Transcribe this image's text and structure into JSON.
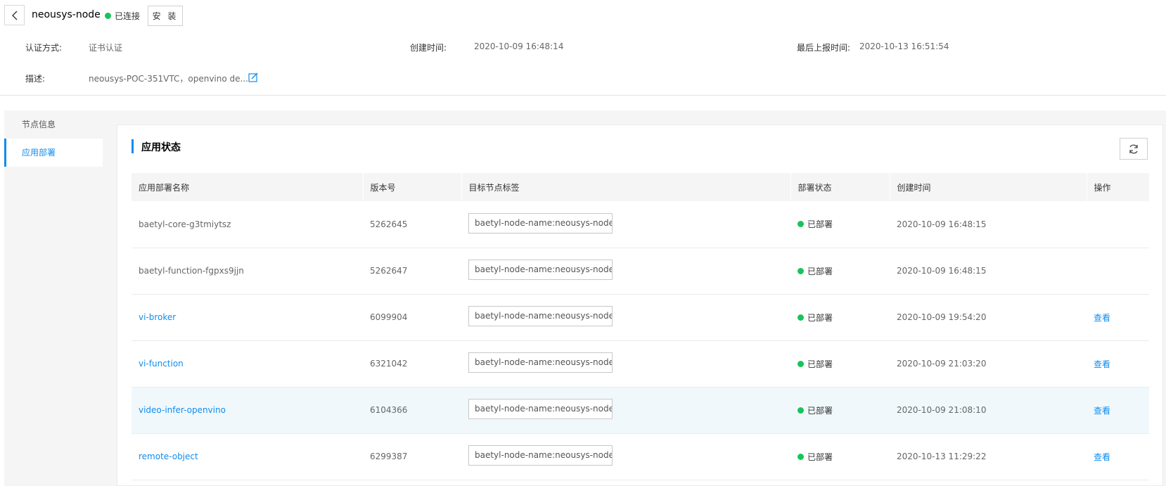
{
  "header": {
    "node_name": "neousys-node",
    "connection_status": "已连接",
    "install_label": "安 装"
  },
  "meta": {
    "auth_label": "认证方式:",
    "auth_value": "证书认证",
    "created_label": "创建时间:",
    "created_value": "2020-10-09 16:48:14",
    "reported_label": "最后上报时间:",
    "reported_value": "2020-10-13 16:51:54",
    "desc_label": "描述:",
    "desc_value": "neousys-POC-351VTC，openvino de..."
  },
  "sidebar": {
    "items": [
      {
        "label": "节点信息"
      },
      {
        "label": "应用部署"
      }
    ]
  },
  "panel": {
    "title": "应用状态"
  },
  "table": {
    "headers": [
      "应用部署名称",
      "版本号",
      "目标节点标签",
      "部署状态",
      "创建时间",
      "操作"
    ],
    "rows": [
      {
        "name": "baetyl-core-g3tmiytsz",
        "version": "5262645",
        "tag": "baetyl-node-name:neousys-node",
        "status": "已部署",
        "created": "2020-10-09 16:48:15",
        "action": ""
      },
      {
        "name": "baetyl-function-fgpxs9jjn",
        "version": "5262647",
        "tag": "baetyl-node-name:neousys-node",
        "status": "已部署",
        "created": "2020-10-09 16:48:15",
        "action": ""
      },
      {
        "name": "vi-broker",
        "version": "6099904",
        "tag": "baetyl-node-name:neousys-node",
        "status": "已部署",
        "created": "2020-10-09 19:54:20",
        "action": "查看"
      },
      {
        "name": "vi-function",
        "version": "6321042",
        "tag": "baetyl-node-name:neousys-node",
        "status": "已部署",
        "created": "2020-10-09 21:03:20",
        "action": "查看"
      },
      {
        "name": "video-infer-openvino",
        "version": "6104366",
        "tag": "baetyl-node-name:neousys-node",
        "status": "已部署",
        "created": "2020-10-09 21:08:10",
        "action": "查看"
      },
      {
        "name": "remote-object",
        "version": "6299387",
        "tag": "baetyl-node-name:neousys-node",
        "status": "已部署",
        "created": "2020-10-13 11:29:22",
        "action": "查看"
      }
    ]
  },
  "colors": {
    "accent": "#108cee",
    "status_ok": "#18c45a"
  }
}
